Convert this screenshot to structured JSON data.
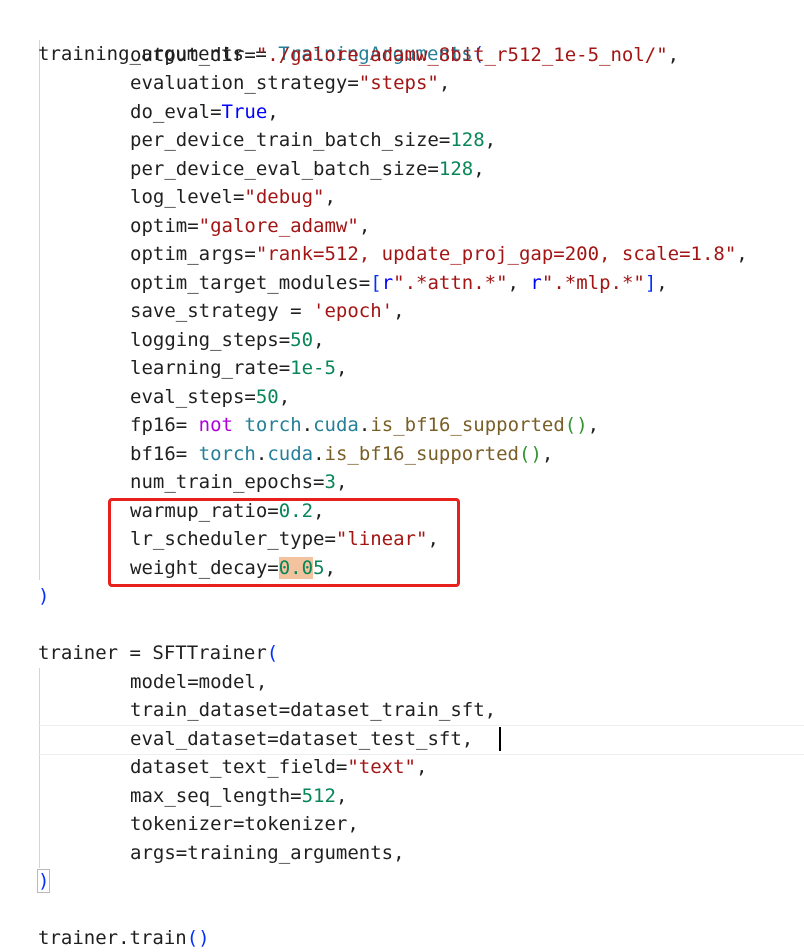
{
  "colors": {
    "variable": "#1f1f1f",
    "class": "#267f99",
    "string": "#a31515",
    "number": "#098658",
    "keyword": "#0000ff",
    "control_keyword": "#af00db",
    "function": "#795e26",
    "bracket": "#0431fa",
    "bracket2": "#319331",
    "highlight_box": "#e8201c",
    "match_highlight": "#f3c3a0"
  },
  "code": {
    "l1": {
      "var": "training_arguments",
      "op": " = ",
      "cls": "TrainingArguments",
      "open": "("
    },
    "l2": {
      "k": "output_dir",
      "eq": "=",
      "s": "\"./galore_adamw_8bit_r512_1e-5_nol/\"",
      "c": ","
    },
    "l3": {
      "k": "evaluation_strategy",
      "eq": "=",
      "s": "\"steps\"",
      "c": ","
    },
    "l4": {
      "k": "do_eval",
      "eq": "=",
      "kw": "True",
      "c": ","
    },
    "l5": {
      "k": "per_device_train_batch_size",
      "eq": "=",
      "n": "128",
      "c": ","
    },
    "l6": {
      "k": "per_device_eval_batch_size",
      "eq": "=",
      "n": "128",
      "c": ","
    },
    "l7": {
      "k": "log_level",
      "eq": "=",
      "s": "\"debug\"",
      "c": ","
    },
    "l8": {
      "k": "optim",
      "eq": "=",
      "s": "\"galore_adamw\"",
      "c": ","
    },
    "l9": {
      "k": "optim_args",
      "eq": "=",
      "s": "\"rank=512, update_proj_gap=200, scale=1.8\"",
      "c": ","
    },
    "l10": {
      "k": "optim_target_modules",
      "eq": "=",
      "ob": "[",
      "r1": "r",
      "s1": "\".*attn.*\"",
      "sep": ", ",
      "r2": "r",
      "s2": "\".*mlp.*\"",
      "cb": "]",
      "c": ","
    },
    "l11": {
      "k": "save_strategy",
      "eq": " = ",
      "s": "'epoch'",
      "c": ","
    },
    "l12": {
      "k": "logging_steps",
      "eq": "=",
      "n": "50",
      "c": ","
    },
    "l13": {
      "k": "learning_rate",
      "eq": "=",
      "n": "1e-5",
      "c": ","
    },
    "l14": {
      "k": "eval_steps",
      "eq": "=",
      "n": "50",
      "c": ","
    },
    "l15": {
      "k": "fp16",
      "eq": "= ",
      "ck": "not",
      "sp": " ",
      "cls": "torch",
      "d1": ".",
      "attr": "cuda",
      "d2": ".",
      "fn": "is_bf16_supported",
      "p": "()",
      "c": ","
    },
    "l16": {
      "k": "bf16",
      "eq": "= ",
      "cls": "torch",
      "d1": ".",
      "attr": "cuda",
      "d2": ".",
      "fn": "is_bf16_supported",
      "p": "()",
      "c": ","
    },
    "l17": {
      "k": "num_train_epochs",
      "eq": "=",
      "n": "3",
      "c": ","
    },
    "l18": {
      "k": "warmup_ratio",
      "eq": "=",
      "n": "0.2",
      "c": ","
    },
    "l19": {
      "k": "lr_scheduler_type",
      "eq": "=",
      "s": "\"linear\"",
      "c": ","
    },
    "l20": {
      "k": "weight_decay",
      "eq": "=",
      "n1": "0.0",
      "n2": "5",
      "c": ","
    },
    "l21": {
      "close": ")"
    },
    "l23": {
      "var": "trainer",
      "op": " = ",
      "cls": "SFTTrainer",
      "open": "("
    },
    "l24": {
      "k": "model",
      "eq": "=",
      "v": "model",
      "c": ","
    },
    "l25": {
      "k": "train_dataset",
      "eq": "=",
      "v": "dataset_train_sft",
      "c": ","
    },
    "l26": {
      "k": "eval_dataset",
      "eq": "=",
      "v": "dataset_test_sft",
      "c": ","
    },
    "l27": {
      "k": "dataset_text_field",
      "eq": "=",
      "s": "\"text\"",
      "c": ","
    },
    "l28": {
      "k": "max_seq_length",
      "eq": "=",
      "n": "512",
      "c": ","
    },
    "l29": {
      "k": "tokenizer",
      "eq": "=",
      "v": "tokenizer",
      "c": ","
    },
    "l30": {
      "k": "args",
      "eq": "=",
      "v": "training_arguments",
      "c": ","
    },
    "l31": {
      "close": ")"
    },
    "l33": {
      "var": "trainer",
      "dot": ".",
      "fn": "train",
      "p": "()"
    }
  }
}
